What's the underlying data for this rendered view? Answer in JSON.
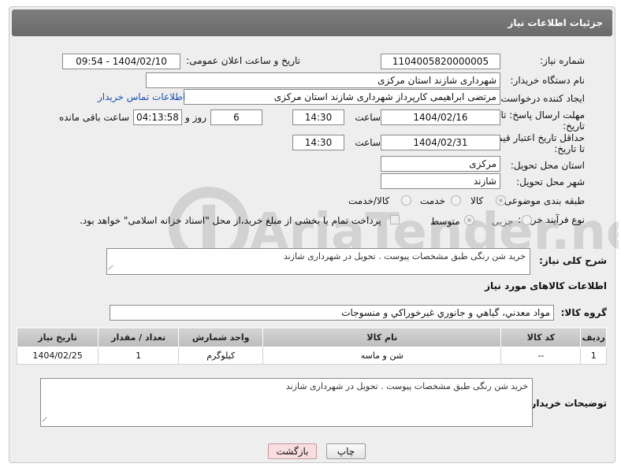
{
  "header": {
    "title": "جزئیات اطلاعات نیاز"
  },
  "need_number": {
    "label": "شماره نیاز:",
    "value": "1104005820000005"
  },
  "announce": {
    "label": "تاریخ و ساعت اعلان عمومی:",
    "value": "1404/02/10 - 09:54"
  },
  "buyer_org": {
    "label": "نام دستگاه خریدار:",
    "value": "شهرداری شازند استان مرکزی"
  },
  "creator": {
    "label": "ایجاد کننده درخواست:",
    "value": "مرتضی ابراهیمی کارپرداز شهرداری شازند استان مرکزی",
    "contact_link": "اطلاعات تماس خریدار"
  },
  "reply_deadline": {
    "label_line1": "مهلت ارسال پاسخ: تا",
    "label_line2": "تاریخ:",
    "date": "1404/02/16",
    "time_label": "ساعت",
    "time": "14:30",
    "days": "6",
    "days_label": "روز و",
    "remaining": "04:13:58",
    "remaining_label": "ساعت باقی مانده"
  },
  "price_validity": {
    "label_line1": "حداقل تاریخ اعتبار قیمت:",
    "label_line2": "تا تاریخ:",
    "date": "1404/02/31",
    "time_label": "ساعت",
    "time": "14:30"
  },
  "delivery_province": {
    "label": "استان محل تحویل:",
    "value": "مرکزی"
  },
  "delivery_city": {
    "label": "شهر محل تحویل:",
    "value": "شازند"
  },
  "category": {
    "label": "طبقه بندی موضوعی:",
    "options": [
      "کالا",
      "خدمت",
      "کالا/خدمت"
    ],
    "selected": "کالا"
  },
  "purchase_process": {
    "label": "نوع فرآیند خرید :",
    "options": [
      "جزیی",
      "متوسط"
    ],
    "selected": "متوسط",
    "note": "پرداخت تمام یا بخشی از مبلغ خرید،از محل \"اسناد خزانه اسلامی\" خواهد بود."
  },
  "description": {
    "label": "شرح کلی نیاز:",
    "value": "خرید شن رنگی طبق مشخصات پیوست . تحویل در شهرداری شازند"
  },
  "goods_info": {
    "title": "اطلاعات کالاهای مورد نیاز"
  },
  "goods_group": {
    "label": "گروه کالا:",
    "value": "مواد معدني، گیاهي و جانوري غيرخوراكي و منسوجات"
  },
  "table": {
    "headers": [
      "ردیف",
      "کد کالا",
      "نام کالا",
      "واحد شمارش",
      "تعداد / مقدار",
      "تاریخ نیاز"
    ],
    "rows": [
      [
        "1",
        "--",
        "شن و ماسه",
        "کیلوگرم",
        "1",
        "1404/02/25"
      ]
    ]
  },
  "buyer_notes": {
    "label": "توضیحات خریدار:",
    "value": "خرید شن رنگی طبق مشخصات پیوست . تحویل در شهرداری شازند"
  },
  "buttons": {
    "print": "چاپ",
    "back": "بازگشت"
  },
  "watermark": {
    "text": "AriaTender.neT"
  }
}
